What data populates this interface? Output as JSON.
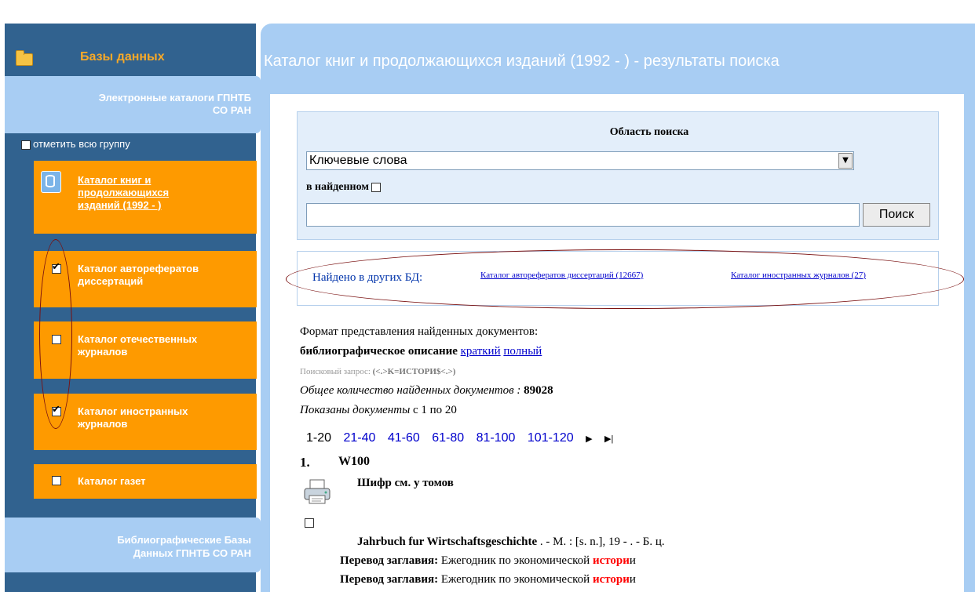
{
  "sidebar": {
    "header": "Базы данных",
    "section_top": [
      "Электронные каталоги ГПНТБ",
      "СО РАН"
    ],
    "select_all": "отметить всю группу",
    "catalogs": [
      {
        "lines": [
          "Каталог книг и",
          "продолжающихся",
          "изданий (1992 - )"
        ],
        "checked": null
      },
      {
        "lines": [
          "Каталог авторефератов",
          "диссертаций"
        ],
        "checked": true
      },
      {
        "lines": [
          "Каталог отечественных",
          "журналов"
        ],
        "checked": false
      },
      {
        "lines": [
          "Каталог иностранных",
          "журналов"
        ],
        "checked": true
      },
      {
        "lines": [
          "Каталог газет"
        ],
        "checked": false
      }
    ],
    "section_bottom": [
      "Библиографические Базы",
      "Данных ГПНТБ СО РАН"
    ]
  },
  "page_title": "Каталог книг и продолжающихся изданий (1992 - ) - результаты поиска",
  "search": {
    "area_label": "Область поиска",
    "area_value": "Ключевые слова",
    "in_found_label": "в найденном",
    "query_value": "",
    "button": "Поиск"
  },
  "found_other": {
    "label": "Найдено в других БД:",
    "link1": "Каталог авторефератов диссертаций (12667)",
    "link2": "Каталог иностранных журналов (27)"
  },
  "format": {
    "title": "Формат представления найденных документов:",
    "current": "библиографическое описание",
    "short": "краткий",
    "full": "полный"
  },
  "query": {
    "label": "Поисковый запрос:",
    "value": "(<.>K=ИСТОРИ$<.>)"
  },
  "total": {
    "label": "Общее количество найденных документов",
    "value": "89028"
  },
  "shown": {
    "label": "Показаны документы",
    "range": "с 1 по 20"
  },
  "pager": {
    "current": "1-20",
    "pages": [
      "21-40",
      "41-60",
      "61-80",
      "81-100",
      "101-120"
    ],
    "next": "▶",
    "last": "▶|"
  },
  "record": {
    "number": "1.",
    "code": "W100",
    "cipher": "Шифр см. у томов",
    "title": "Jahrbuch fur Wirtschaftsgeschichte",
    "imprint": ". - M. : [s. n.], 19 - . - Б. ц.",
    "translation_label": "Перевод заглавия:",
    "translation_pre": "Ежегодник по экономической ",
    "translation_hl": "истори",
    "translation_post": "и"
  }
}
